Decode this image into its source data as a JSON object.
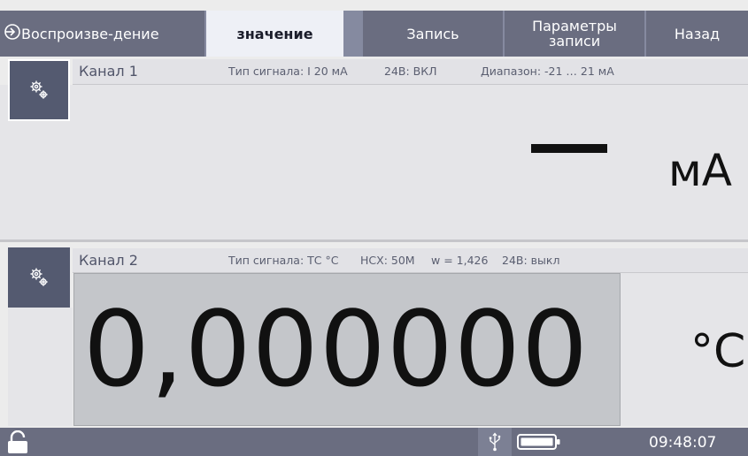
{
  "topbar": {
    "tabs": {
      "play": "Воспроизве-дение",
      "value": "значение",
      "record": "Запись",
      "record_params": "Параметры записи",
      "back": "Назад"
    }
  },
  "channel1": {
    "title": "Канал 1",
    "signal_type": "Тип сигнала: I 20 мА",
    "power": "24В: ВКЛ",
    "range": "Диапазон: -21 … 21 мА",
    "unit": "мА"
  },
  "channel2": {
    "title": "Канал 2",
    "signal_type": "Тип сигнала: ТС °C",
    "nsx": "НСХ: 50М",
    "w": "w = 1,426",
    "power": "24В: выкл",
    "value": "0,000000",
    "unit": "°C"
  },
  "statusbar": {
    "time": "09:48:07"
  },
  "icons": [
    "playback-icon",
    "gear-icon",
    "lock-icon",
    "usb-icon",
    "battery-icon"
  ],
  "colors": {
    "bar": "#6a6d80",
    "active_tab": "#eef0f6",
    "gear_button": "#545a70",
    "readout_bg": "#c4c6ca"
  }
}
